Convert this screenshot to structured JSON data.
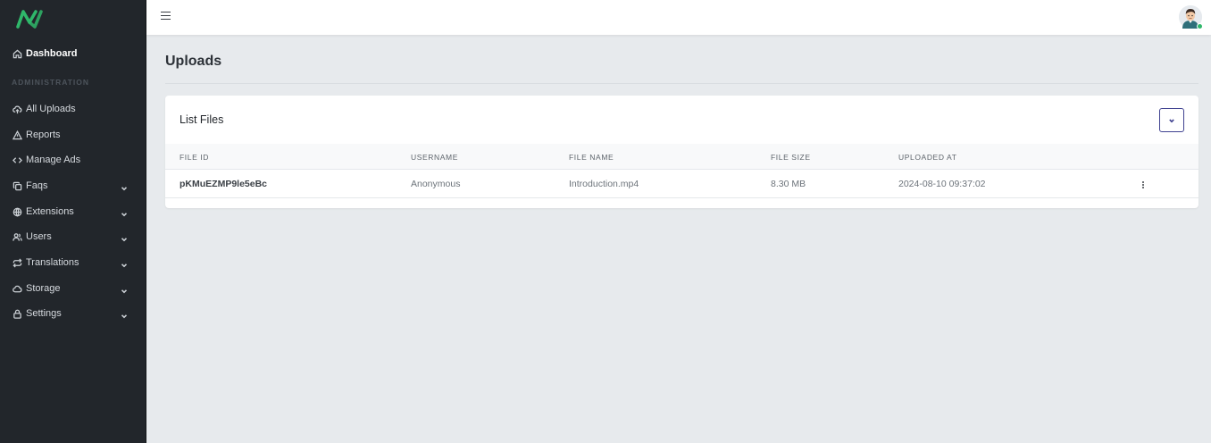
{
  "sidebar": {
    "items": [
      {
        "label": "Dashboard",
        "icon": "home-icon",
        "active": true
      },
      {
        "label": "All Uploads",
        "icon": "upload-cloud-icon"
      },
      {
        "label": "Reports",
        "icon": "alert-triangle-icon"
      },
      {
        "label": "Manage Ads",
        "icon": "code-icon"
      },
      {
        "label": "Faqs",
        "icon": "copy-icon",
        "expandable": true
      },
      {
        "label": "Extensions",
        "icon": "globe-icon",
        "expandable": true
      },
      {
        "label": "Users",
        "icon": "users-icon",
        "expandable": true
      },
      {
        "label": "Translations",
        "icon": "repeat-icon",
        "expandable": true
      },
      {
        "label": "Storage",
        "icon": "cloud-icon",
        "expandable": true
      },
      {
        "label": "Settings",
        "icon": "lock-icon",
        "expandable": true
      }
    ],
    "section_label": "ADMINISTRATION"
  },
  "page": {
    "title": "Uploads"
  },
  "card": {
    "title": "List Files"
  },
  "table": {
    "columns": [
      "FILE ID",
      "USERNAME",
      "FILE NAME",
      "FILE SIZE",
      "UPLOADED AT"
    ],
    "rows": [
      {
        "file_id": "pKMuEZMP9le5eBc",
        "username": "Anonymous",
        "file_name": "Introduction.mp4",
        "file_size": "8.30 MB",
        "uploaded_at": "2024-08-10 09:37:02"
      }
    ]
  },
  "colors": {
    "sidebar_bg": "#22262b",
    "accent": "#3f4190",
    "logo_green": "#2fb76a",
    "online_status": "#2fb76a"
  }
}
